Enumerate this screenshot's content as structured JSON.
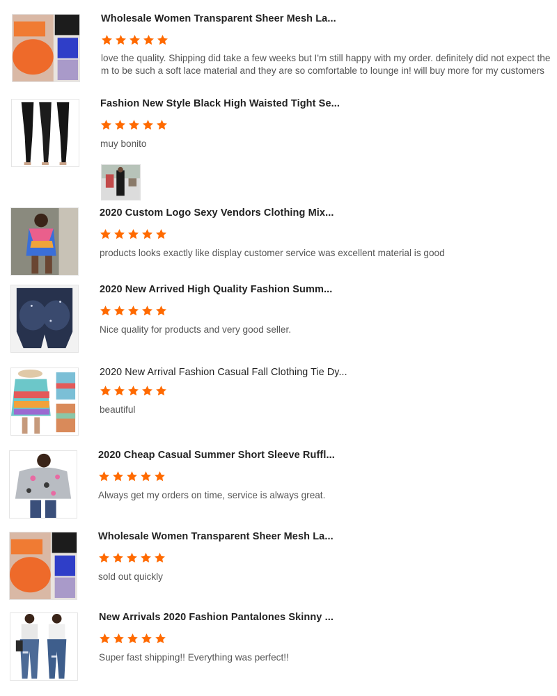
{
  "colors": {
    "star": "#ff6a00",
    "title": "#222222",
    "text": "#555555"
  },
  "reviews": [
    {
      "title": "Wholesale Women Transparent Sheer Mesh La...",
      "rating": 5,
      "text": "love the quality. Shipping did take a few weeks but I'm still happy with my order. definitely did not expect them to be such a soft lace material and they are so comfortable to lounge in! will buy more for my customers",
      "thumb_icon": "orange-lace-shorts-image"
    },
    {
      "title": "Fashion New Style Black High Waisted Tight Se...",
      "rating": 5,
      "text": "muy bonito",
      "thumb_icon": "black-leggings-image",
      "attachment_icon": "customer-photo-image"
    },
    {
      "title": "2020 Custom Logo Sexy Vendors Clothing Mix...",
      "rating": 5,
      "text": "products looks exactly like display customer service was excellent material is good",
      "thumb_icon": "tie-dye-bodysuit-image"
    },
    {
      "title": "2020 New Arrived High Quality Fashion Summ...",
      "rating": 5,
      "text": "Nice quality for products and very good seller.",
      "thumb_icon": "denim-shorts-image"
    },
    {
      "title": "2020 New Arrival Fashion Casual Fall Clothing Tie Dy...",
      "rating": 5,
      "text": "beautiful",
      "thumb_icon": "tie-dye-sweater-image"
    },
    {
      "title": "2020 Cheap Casual Summer Short Sleeve Ruffl...",
      "rating": 5,
      "text": "Always get my orders on time, service is always great.",
      "thumb_icon": "leopard-top-image"
    },
    {
      "title": "Wholesale Women Transparent Sheer Mesh La...",
      "rating": 5,
      "text": "sold out quickly",
      "thumb_icon": "orange-lace-shorts-image"
    },
    {
      "title": "New Arrivals 2020 Fashion Pantalones Skinny ...",
      "rating": 5,
      "text": "Super fast shipping!! Everything was perfect!!",
      "thumb_icon": "ripped-jeans-image"
    }
  ]
}
